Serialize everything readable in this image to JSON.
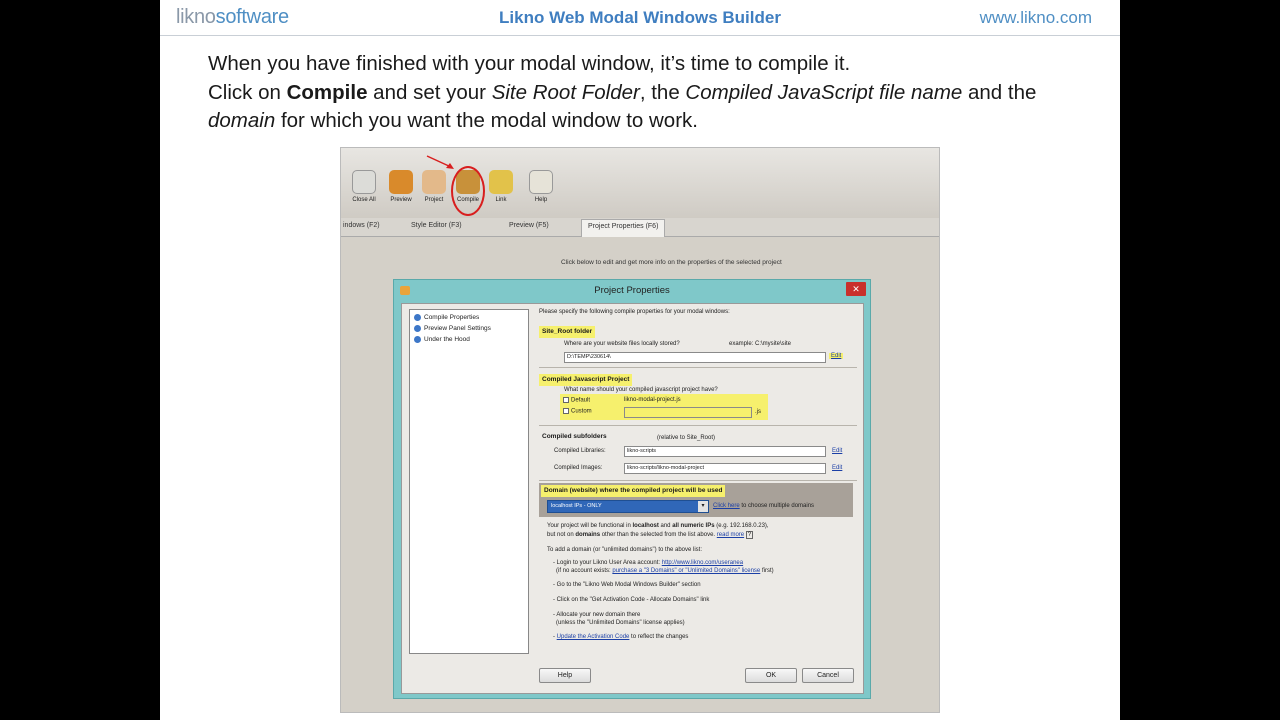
{
  "header": {
    "logo_light": "likno",
    "logo_accent": "software",
    "title": "Likno Web Modal Windows Builder",
    "url": "www.likno.com"
  },
  "intro": {
    "line1": "When you have finished with your modal window, it’s time to compile it.",
    "l2_a": "Click on ",
    "l2_b": "Compile",
    "l2_c": " and set your ",
    "l2_d": "Site Root Folder",
    "l2_e": ", the ",
    "l2_f": "Compiled JavaScript file name",
    "l2_g": " and the",
    "l3_a": "domain",
    "l3_b": " for  which you want the modal window to work."
  },
  "toolbar": {
    "items": [
      "Close All",
      "Preview",
      "Project",
      "Compile",
      "Link",
      "Help"
    ]
  },
  "tabs": [
    "indows (F2)",
    "Style Editor (F3)",
    "Preview (F5)",
    "Project Properties (F6)"
  ],
  "hint": "Click below to edit and get more info on the properties of the selected project",
  "dialog": {
    "title": "Project Properties",
    "close": "✕",
    "tree": [
      "Compile Properties",
      "Preview Panel Settings",
      "Under the Hood"
    ],
    "intro": "Please specify the following compile properties for your modal windows:",
    "site_root": {
      "heading": "Site_Root folder",
      "question": "Where are your website files locally stored?",
      "example": "example: C:\\mysite\\site",
      "value": "D:\\TEMP\\230614\\",
      "edit": "Edit"
    },
    "compiled_js": {
      "heading": "Compiled Javascript Project",
      "question": "What name should your compiled javascript project have?",
      "default_label": "Default",
      "default_value": "likno-modal-project.js",
      "custom_label": "Custom",
      "ext": ".js"
    },
    "subfolders": {
      "heading": "Compiled subfolders",
      "note": "(relative to Site_Root)",
      "lib_label": "Compiled Libraries:",
      "lib_value": "likno-scripts",
      "img_label": "Compiled Images:",
      "img_value": "likno-scripts/likno-modal-project",
      "edit": "Edit"
    },
    "domain": {
      "heading": "Domain (website) where the compiled project will be used",
      "select": "localhost IPs - ONLY",
      "click_here": "Click here",
      "choose_multi": " to choose multiple domains",
      "info1_a": "Your project will be functional in ",
      "info1_b": "localhost",
      "info1_c": " and ",
      "info1_d": "all numeric IPs",
      "info1_e": " (e.g. 192.168.0.23),",
      "info2_a": "but not on ",
      "info2_b": "domains",
      "info2_c": " other than the selected from the list above. ",
      "info2_d": "read more",
      "info2_q": "?",
      "add_title": "To add a domain (or \"unlimited domains\") to the above list:",
      "s1a": "- Login to your Likno User Area account: ",
      "s1b": "http://www.likno.com/useranea",
      "s1c": "(if no account exists: ",
      "s1d": "purchase a \"3 Domains\" or \"Unlimited Domains\" license",
      "s1e": " first)",
      "s2": "- Go to the \"Likno Web Modal Windows Builder\" section",
      "s3": "- Click on the \"Get Activation Code - Allocate Domains\" link",
      "s4a": "- Allocate your new domain there",
      "s4b": "(unless the \"Unlimited Domains\" license applies)",
      "s5a": "- ",
      "s5b": "Update the Activation Code",
      "s5c": " to reflect the changes"
    },
    "buttons": {
      "help": "Help",
      "ok": "OK",
      "cancel": "Cancel"
    }
  }
}
